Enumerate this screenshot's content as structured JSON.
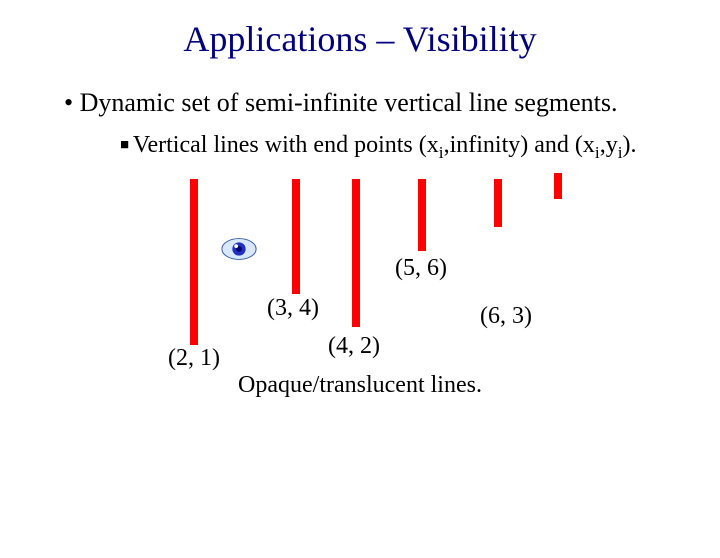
{
  "title": "Applications – Visibility",
  "bullet1": "Dynamic set of semi-infinite vertical line segments.",
  "bullet2_prefix": "Vertical lines with end points (x",
  "bullet2_mid1": ",infinity) and (x",
  "bullet2_mid2": ",y",
  "bullet2_suffix": ").",
  "sub_i": "i",
  "labels": {
    "l1": "(2, 1)",
    "l2": "(3, 4)",
    "l3": "(4, 2)",
    "l4": "(5, 6)",
    "l5": "(6, 3)"
  },
  "caption": "Opaque/translucent lines."
}
